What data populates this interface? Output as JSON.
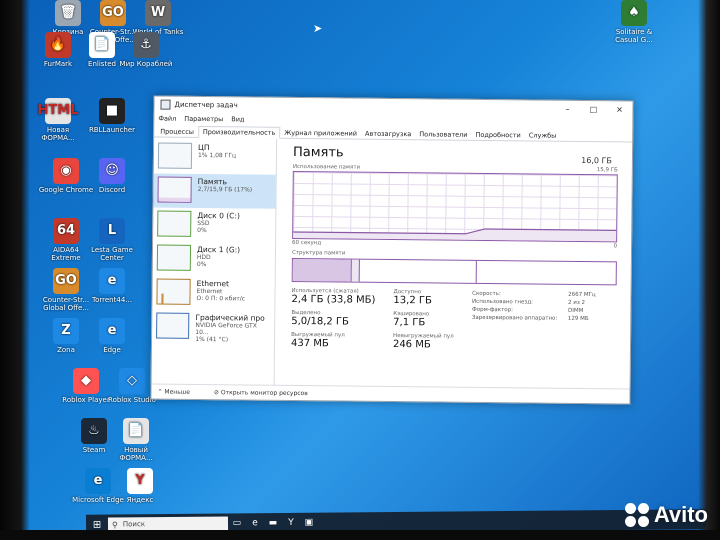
{
  "desktop": {
    "icons": [
      {
        "label": "Корзина",
        "color": "#9aa7b3",
        "glyph": "🗑"
      },
      {
        "label": "Counter-Str... Global Offe...",
        "color": "#d78b2c",
        "glyph": "GO"
      },
      {
        "label": "World of Tanks",
        "color": "#6a6a6a",
        "glyph": "W"
      },
      {
        "label": "FurMark",
        "color": "#c0392b",
        "glyph": "🔥"
      },
      {
        "label": "Enlisted",
        "color": "#ffffff",
        "glyph": "📄"
      },
      {
        "label": "Мир Кораблей",
        "color": "#505a66",
        "glyph": "⚓"
      },
      {
        "label": "Новая ФОРМА...",
        "color": "#e5e5e5",
        "glyph": "HTML"
      },
      {
        "label": "RBLLauncher",
        "color": "#222222",
        "glyph": "■"
      },
      {
        "label": "Google Chrome",
        "color": "#e8453c",
        "glyph": "◉"
      },
      {
        "label": "Discord",
        "color": "#5865f2",
        "glyph": "☺"
      },
      {
        "label": "AIDA64 Extreme",
        "color": "#c0392b",
        "glyph": "64"
      },
      {
        "label": "Lesta Game Center",
        "color": "#1565c0",
        "glyph": "L"
      },
      {
        "label": "Counter-Str... Global Offe...",
        "color": "#d78b2c",
        "glyph": "GO"
      },
      {
        "label": "Torrent44...",
        "color": "#1e88e5",
        "glyph": "e"
      },
      {
        "label": "Zona",
        "color": "#1e88e5",
        "glyph": "Z"
      },
      {
        "label": "Edge",
        "color": "#1e88e5",
        "glyph": "e"
      },
      {
        "label": "Roblox Player",
        "color": "#ff5252",
        "glyph": "◆"
      },
      {
        "label": "Roblox Studio",
        "color": "#1e88e5",
        "glyph": "◇"
      },
      {
        "label": "Steam",
        "color": "#1b2838",
        "glyph": "♨"
      },
      {
        "label": "Новый ФОРМА...",
        "color": "#e5e5e5",
        "glyph": "📄"
      },
      {
        "label": "Microsoft Edge",
        "color": "#0a7ed3",
        "glyph": "e"
      },
      {
        "label": "Яндекс",
        "color": "#ffffff",
        "glyph": "Y"
      },
      {
        "label": "Solitaire & Casual G...",
        "color": "#2e7d32",
        "glyph": "♠"
      }
    ]
  },
  "window": {
    "title": "Диспетчер задач",
    "minimize": "–",
    "maximize": "□",
    "close": "✕"
  },
  "menu": [
    "Файл",
    "Параметры",
    "Вид"
  ],
  "tabs": [
    "Процессы",
    "Производительность",
    "Журнал приложений",
    "Автозагрузка",
    "Пользователи",
    "Подробности",
    "Службы"
  ],
  "sidebar": [
    {
      "name": "ЦП",
      "detail1": "1% 1,08 ГГц",
      "detail2": ""
    },
    {
      "name": "Память",
      "detail1": "2,7/15,9 ГБ (17%)",
      "detail2": ""
    },
    {
      "name": "Диск 0 (C:)",
      "detail1": "SSD",
      "detail2": "0%"
    },
    {
      "name": "Диск 1 (G:)",
      "detail1": "HDD",
      "detail2": "0%"
    },
    {
      "name": "Ethernet",
      "detail1": "Ethernet",
      "detail2": "О: 0 П: 0 кбит/с"
    },
    {
      "name": "Графический про",
      "detail1": "NVIDIA GeForce GTX 10...",
      "detail2": "1% (41 °C)"
    }
  ],
  "memory": {
    "title": "Память",
    "total": "16,0 ГБ",
    "usage_label": "Использование памяти",
    "usage_max": "15,9 ГБ",
    "time_left": "60 секунд",
    "time_right": "0",
    "structure_label": "Структура памяти",
    "usage_fraction": 0.17,
    "stats": {
      "in_use_label": "Используется (сжатая)",
      "in_use_value": "2,4 ГБ (33,8 МБ)",
      "available_label": "Доступно",
      "available_value": "13,2 ГБ",
      "committed_label": "Выделено",
      "committed_value": "5,0/18,2 ГБ",
      "cached_label": "Кэшировано",
      "cached_value": "7,1 ГБ",
      "paged_label": "Выгружаемый пул",
      "paged_value": "437 МБ",
      "nonpaged_label": "Невыгружаемый пул",
      "nonpaged_value": "246 МБ"
    },
    "details": [
      {
        "k": "Скорость:",
        "v": "2667 МГц"
      },
      {
        "k": "Использовано гнезд:",
        "v": "2 из 2"
      },
      {
        "k": "Форм-фактор:",
        "v": "DIMM"
      },
      {
        "k": "Зарезервировано аппаратно:",
        "v": "129 МБ"
      }
    ]
  },
  "footer": {
    "less": "Меньше",
    "resource_monitor": "Открыть монитор ресурсов"
  },
  "taskbar": {
    "search_placeholder": "Поиск"
  },
  "watermark": "Avito"
}
